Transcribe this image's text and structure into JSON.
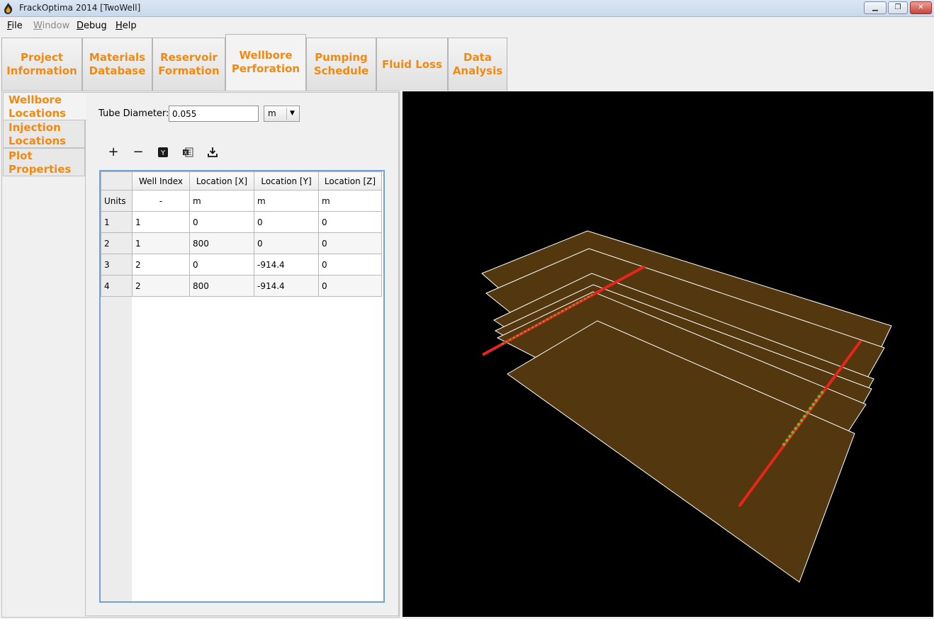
{
  "window": {
    "title": "FrackOptima 2014 [TwoWell]",
    "minimize": "▁",
    "restore": "❐",
    "close": "✕"
  },
  "menu": {
    "file": {
      "first": "F",
      "rest": "ile"
    },
    "window": {
      "first": "W",
      "rest": "indow"
    },
    "debug": {
      "first": "D",
      "rest": "ebug"
    },
    "help": {
      "first": "H",
      "rest": "elp"
    }
  },
  "tabs": [
    {
      "line1": "Project",
      "line2": "Information"
    },
    {
      "line1": "Materials",
      "line2": "Database"
    },
    {
      "line1": "Reservoir",
      "line2": "Formation"
    },
    {
      "line1": "Wellbore",
      "line2": "Perforation"
    },
    {
      "line1": "Pumping",
      "line2": "Schedule"
    },
    {
      "line1": "Fluid Loss",
      "line2": ""
    },
    {
      "line1": "Data",
      "line2": "Analysis"
    }
  ],
  "subtabs": [
    {
      "line1": "Wellbore",
      "line2": "Locations"
    },
    {
      "line1": "Injection",
      "line2": "Locations"
    },
    {
      "line1": "Plot",
      "line2": "Properties"
    }
  ],
  "form": {
    "tube_diameter_label": "Tube Diameter:",
    "tube_diameter_value": "0.055",
    "unit_selected": "m"
  },
  "toolbar": {
    "add": "+",
    "remove": "−",
    "paste_y_icon": "Y",
    "excel_icon": "X",
    "import_icon": "⤓"
  },
  "table": {
    "headers": [
      "Well Index",
      "Location [X]",
      "Location [Y]",
      "Location [Z]"
    ],
    "units_label": "Units",
    "units": [
      "-",
      "m",
      "m",
      "m"
    ],
    "rows": [
      {
        "num": "1",
        "cells": [
          "1",
          "0",
          "0",
          "0"
        ]
      },
      {
        "num": "2",
        "cells": [
          "1",
          "800",
          "0",
          "0"
        ]
      },
      {
        "num": "3",
        "cells": [
          "2",
          "0",
          "-914.4",
          "0"
        ]
      },
      {
        "num": "4",
        "cells": [
          "2",
          "800",
          "-914.4",
          "0"
        ]
      }
    ]
  },
  "colors": {
    "accent": "#f08a11",
    "layer_fill": "#53370e",
    "layer_edge": "#ffffff",
    "well": "#e8251a",
    "perforation": "#6fb03a"
  }
}
